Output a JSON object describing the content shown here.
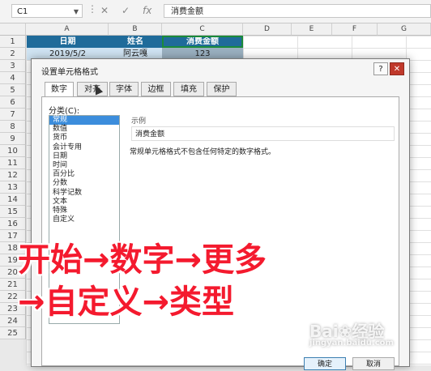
{
  "formula_bar": {
    "name_box": "C1",
    "cancel_icon": "✕",
    "confirm_icon": "✓",
    "fx_icon": "fx",
    "content": "消费金额"
  },
  "columns": [
    "A",
    "B",
    "C",
    "D",
    "E",
    "F",
    "G"
  ],
  "rows": [
    "1",
    "2",
    "3",
    "4",
    "5",
    "6",
    "7",
    "8",
    "9",
    "10",
    "11",
    "12",
    "13",
    "14",
    "15",
    "16",
    "17",
    "18",
    "19",
    "20",
    "21",
    "22",
    "23",
    "24",
    "25"
  ],
  "cells": {
    "a1": "日期",
    "b1": "姓名",
    "c1": "消费金额",
    "a2": "2019/5/2",
    "b2": "阿云嘎",
    "c2": "123"
  },
  "dialog": {
    "title": "设置单元格格式",
    "help": "?",
    "close": "✕",
    "tabs": [
      "数字",
      "对齐",
      "字体",
      "边框",
      "填充",
      "保护"
    ],
    "category_label": "分类(C):",
    "categories": [
      "常规",
      "数值",
      "货币",
      "会计专用",
      "日期",
      "时间",
      "百分比",
      "分数",
      "科学记数",
      "文本",
      "特殊",
      "自定义"
    ],
    "sample_label": "示例",
    "sample_value": "消费金额",
    "description": "常规单元格格式不包含任何特定的数字格式。",
    "ok": "确定",
    "cancel": "取消"
  },
  "overlay": {
    "line1": "开始→数字→更多",
    "line2": "→自定义→类型"
  },
  "watermark": {
    "brand": "Bai❀经验",
    "sub": "jingyan.baidu.com"
  }
}
